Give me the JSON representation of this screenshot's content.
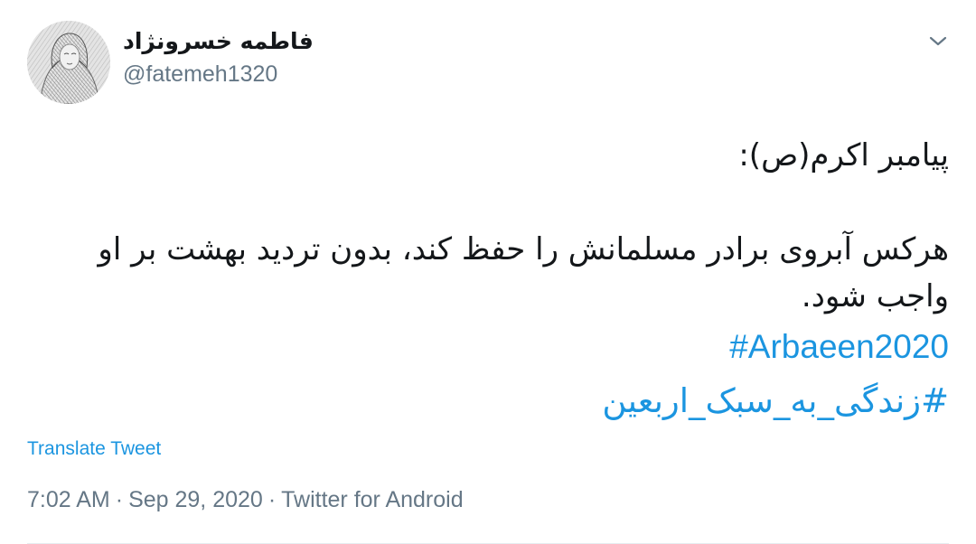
{
  "user": {
    "display_name": "فاطمه خسرونژاد",
    "username": "@fatemeh1320"
  },
  "tweet": {
    "lines": [
      "پیامبر اکرم(ص):",
      "هرکس آبروی برادر مسلمانش را حفظ کند، بدون تردید بهشت بر او واجب شود."
    ],
    "hashtags": [
      "#Arbaeen2020",
      "#زندگی_به_سبک_اربعین"
    ]
  },
  "actions": {
    "translate_label": "Translate Tweet",
    "more_icon": "chevron-down-icon"
  },
  "meta": {
    "time": "7:02 AM",
    "separator": "·",
    "date": "Sep 29, 2020",
    "source": "Twitter for Android"
  },
  "colors": {
    "link": "#1b95e0",
    "secondary": "#657786",
    "text": "#14171a"
  }
}
